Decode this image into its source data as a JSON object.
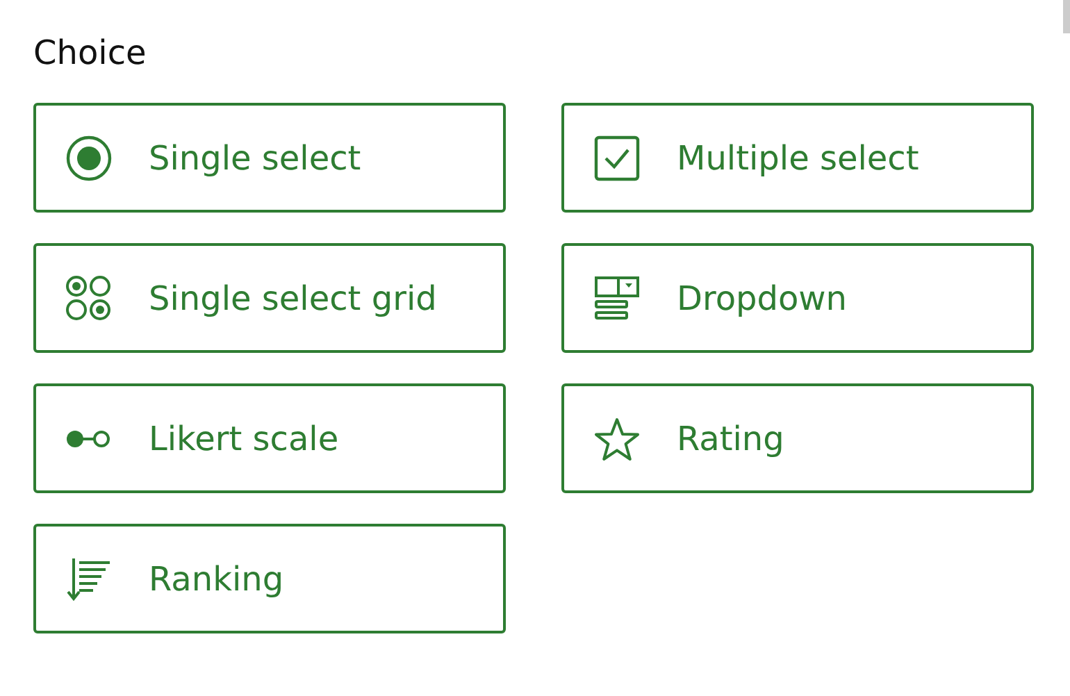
{
  "section": {
    "title": "Choice"
  },
  "items": [
    {
      "label": "Single select",
      "kind": "radio"
    },
    {
      "label": "Multiple select",
      "kind": "checkbox"
    },
    {
      "label": "Single select grid",
      "kind": "radio-grid"
    },
    {
      "label": "Dropdown",
      "kind": "dropdown"
    },
    {
      "label": "Likert scale",
      "kind": "likert"
    },
    {
      "label": "Rating",
      "kind": "star"
    },
    {
      "label": "Ranking",
      "kind": "ranking"
    }
  ]
}
